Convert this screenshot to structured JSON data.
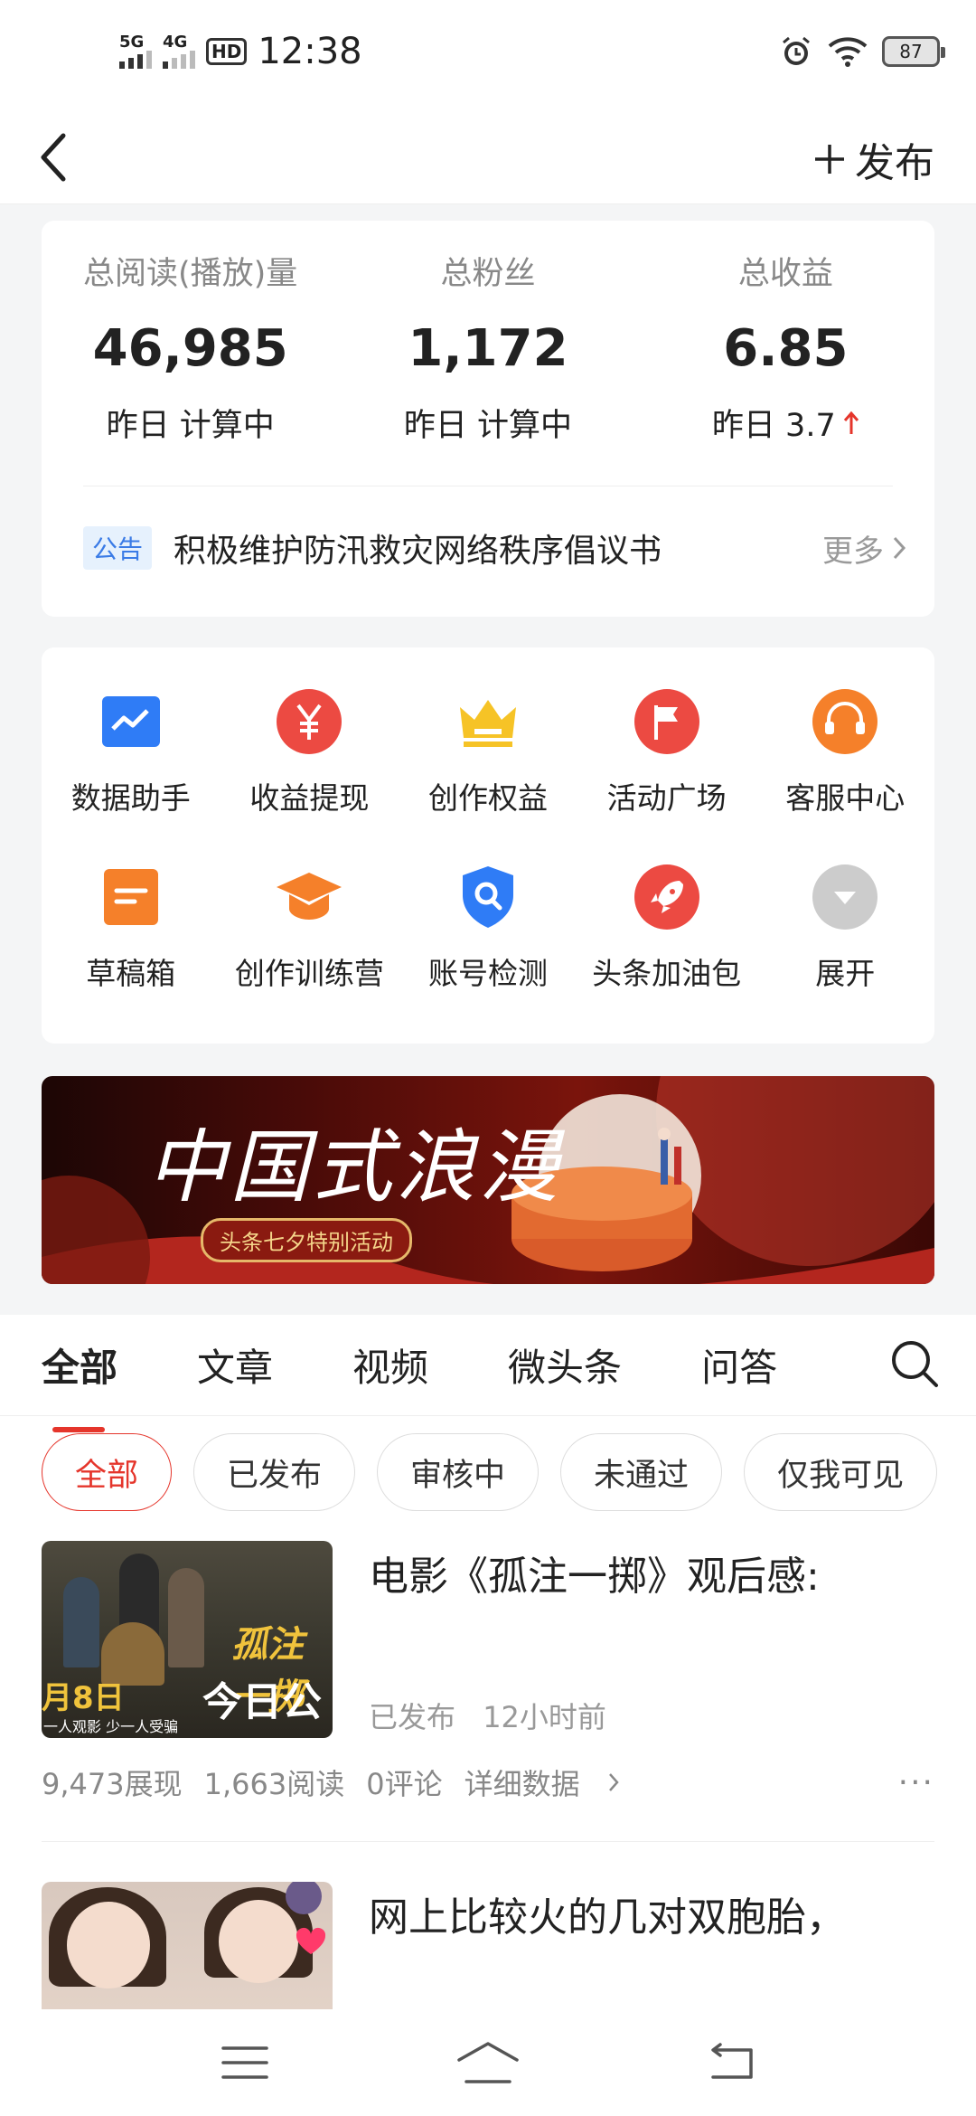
{
  "status_bar": {
    "time": "12:38",
    "net1": "5G",
    "net2": "4G",
    "hd": "HD",
    "battery": "87"
  },
  "nav": {
    "publish_label": "发布"
  },
  "stats": [
    {
      "label": "总阅读(播放)量",
      "value": "46,985",
      "sub": "昨日 计算中"
    },
    {
      "label": "总粉丝",
      "value": "1,172",
      "sub": "昨日 计算中"
    },
    {
      "label": "总收益",
      "value": "6.85",
      "sub": "昨日 3.7",
      "trend": "up"
    }
  ],
  "notice": {
    "tag": "公告",
    "text": "积极维护防汛救灾网络秩序倡议书",
    "more": "更多"
  },
  "tools": [
    {
      "label": "数据助手",
      "icon": "chart-icon",
      "color": "#2f7cf6"
    },
    {
      "label": "收益提现",
      "icon": "yen-icon",
      "color": "#ec4a42"
    },
    {
      "label": "创作权益",
      "icon": "crown-icon",
      "color": "#f6c326"
    },
    {
      "label": "活动广场",
      "icon": "flag-icon",
      "color": "#ec4a42"
    },
    {
      "label": "客服中心",
      "icon": "headset-icon",
      "color": "#f5802a"
    },
    {
      "label": "草稿箱",
      "icon": "draft-icon",
      "color": "#f5802a"
    },
    {
      "label": "创作训练营",
      "icon": "graduation-cap-icon",
      "color": "#f5802a"
    },
    {
      "label": "账号检测",
      "icon": "shield-search-icon",
      "color": "#2f7cf6"
    },
    {
      "label": "头条加油包",
      "icon": "rocket-icon",
      "color": "#ec4a42"
    },
    {
      "label": "展开",
      "icon": "expand-icon",
      "color": "#cccccc"
    }
  ],
  "banner": {
    "title": "中国式浪漫",
    "subtitle": "头条七夕特别活动"
  },
  "tabs": [
    "全部",
    "文章",
    "视频",
    "微头条",
    "问答"
  ],
  "filters": [
    "全部",
    "已发布",
    "审核中",
    "未通过",
    "仅我可见"
  ],
  "articles": [
    {
      "title": "电影《孤注一掷》观后感:",
      "status": "已发布",
      "time": "12小时前",
      "impressions": "9,473展现",
      "reads": "1,663阅读",
      "comments": "0评论",
      "detail": "详细数据",
      "thumb_text": {
        "big": "今日公映",
        "date": "月8日",
        "cap": "一人观影 少一人受骗",
        "brush": "孤注一掷"
      }
    },
    {
      "title": "网上比较火的几对双胞胎，"
    }
  ],
  "colors": {
    "accent": "#e5352b",
    "muted": "#999999",
    "background": "#f4f5f6"
  }
}
